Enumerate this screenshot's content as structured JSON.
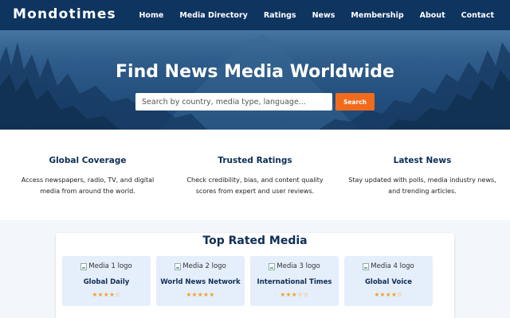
{
  "header": {
    "brand": "Mondotimes",
    "nav": [
      "Home",
      "Media Directory",
      "Ratings",
      "News",
      "Membership",
      "About",
      "Contact"
    ]
  },
  "hero": {
    "title": "Find News Media Worldwide",
    "search_placeholder": "Search by country, media type, language...",
    "search_button": "Search"
  },
  "features": [
    {
      "title": "Global Coverage",
      "text": "Access newspapers, radio, TV, and digital media from around the world."
    },
    {
      "title": "Trusted Ratings",
      "text": "Check credibility, bias, and content quality scores from expert and user reviews."
    },
    {
      "title": "Latest News",
      "text": "Stay updated with polls, media industry news, and trending articles."
    }
  ],
  "top_rated": {
    "title": "Top Rated Media",
    "items": [
      {
        "logo_alt": "Media 1 logo",
        "name": "Global Daily",
        "stars": "★★★★☆"
      },
      {
        "logo_alt": "Media 2 logo",
        "name": "World News Network",
        "stars": "★★★★★"
      },
      {
        "logo_alt": "Media 3 logo",
        "name": "International Times",
        "stars": "★★★☆☆"
      },
      {
        "logo_alt": "Media 4 logo",
        "name": "Global Voice",
        "stars": "★★★★☆"
      }
    ]
  },
  "colors": {
    "navbar": "#0e3460",
    "accent": "#f26b1d",
    "heading": "#0e2e55",
    "card": "#e5eefb",
    "star": "#f0a020"
  }
}
